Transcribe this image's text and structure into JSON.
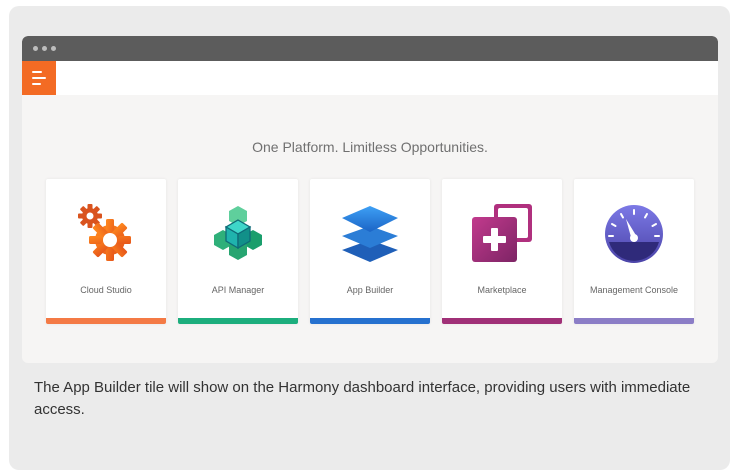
{
  "window": {
    "controls": [
      "window-dot",
      "window-dot",
      "window-dot"
    ]
  },
  "appbar": {
    "menu_icon": "menu-icon",
    "accent": "#f36b24"
  },
  "tagline": "One Platform. Limitless Opportunities.",
  "tiles": [
    {
      "label": "Cloud Studio",
      "icon": "gears-icon",
      "accent": "#f47a45"
    },
    {
      "label": "API Manager",
      "icon": "hexagon-cube-icon",
      "accent": "#1cae7d"
    },
    {
      "label": "App Builder",
      "icon": "layers-icon",
      "accent": "#2671cf"
    },
    {
      "label": "Marketplace",
      "icon": "add-window-icon",
      "accent": "#a03077"
    },
    {
      "label": "Management Console",
      "icon": "gauge-icon",
      "accent": "#8b7dc6"
    }
  ],
  "caption": "The App Builder tile will show on the Harmony dashboard interface, providing users with immediate access."
}
